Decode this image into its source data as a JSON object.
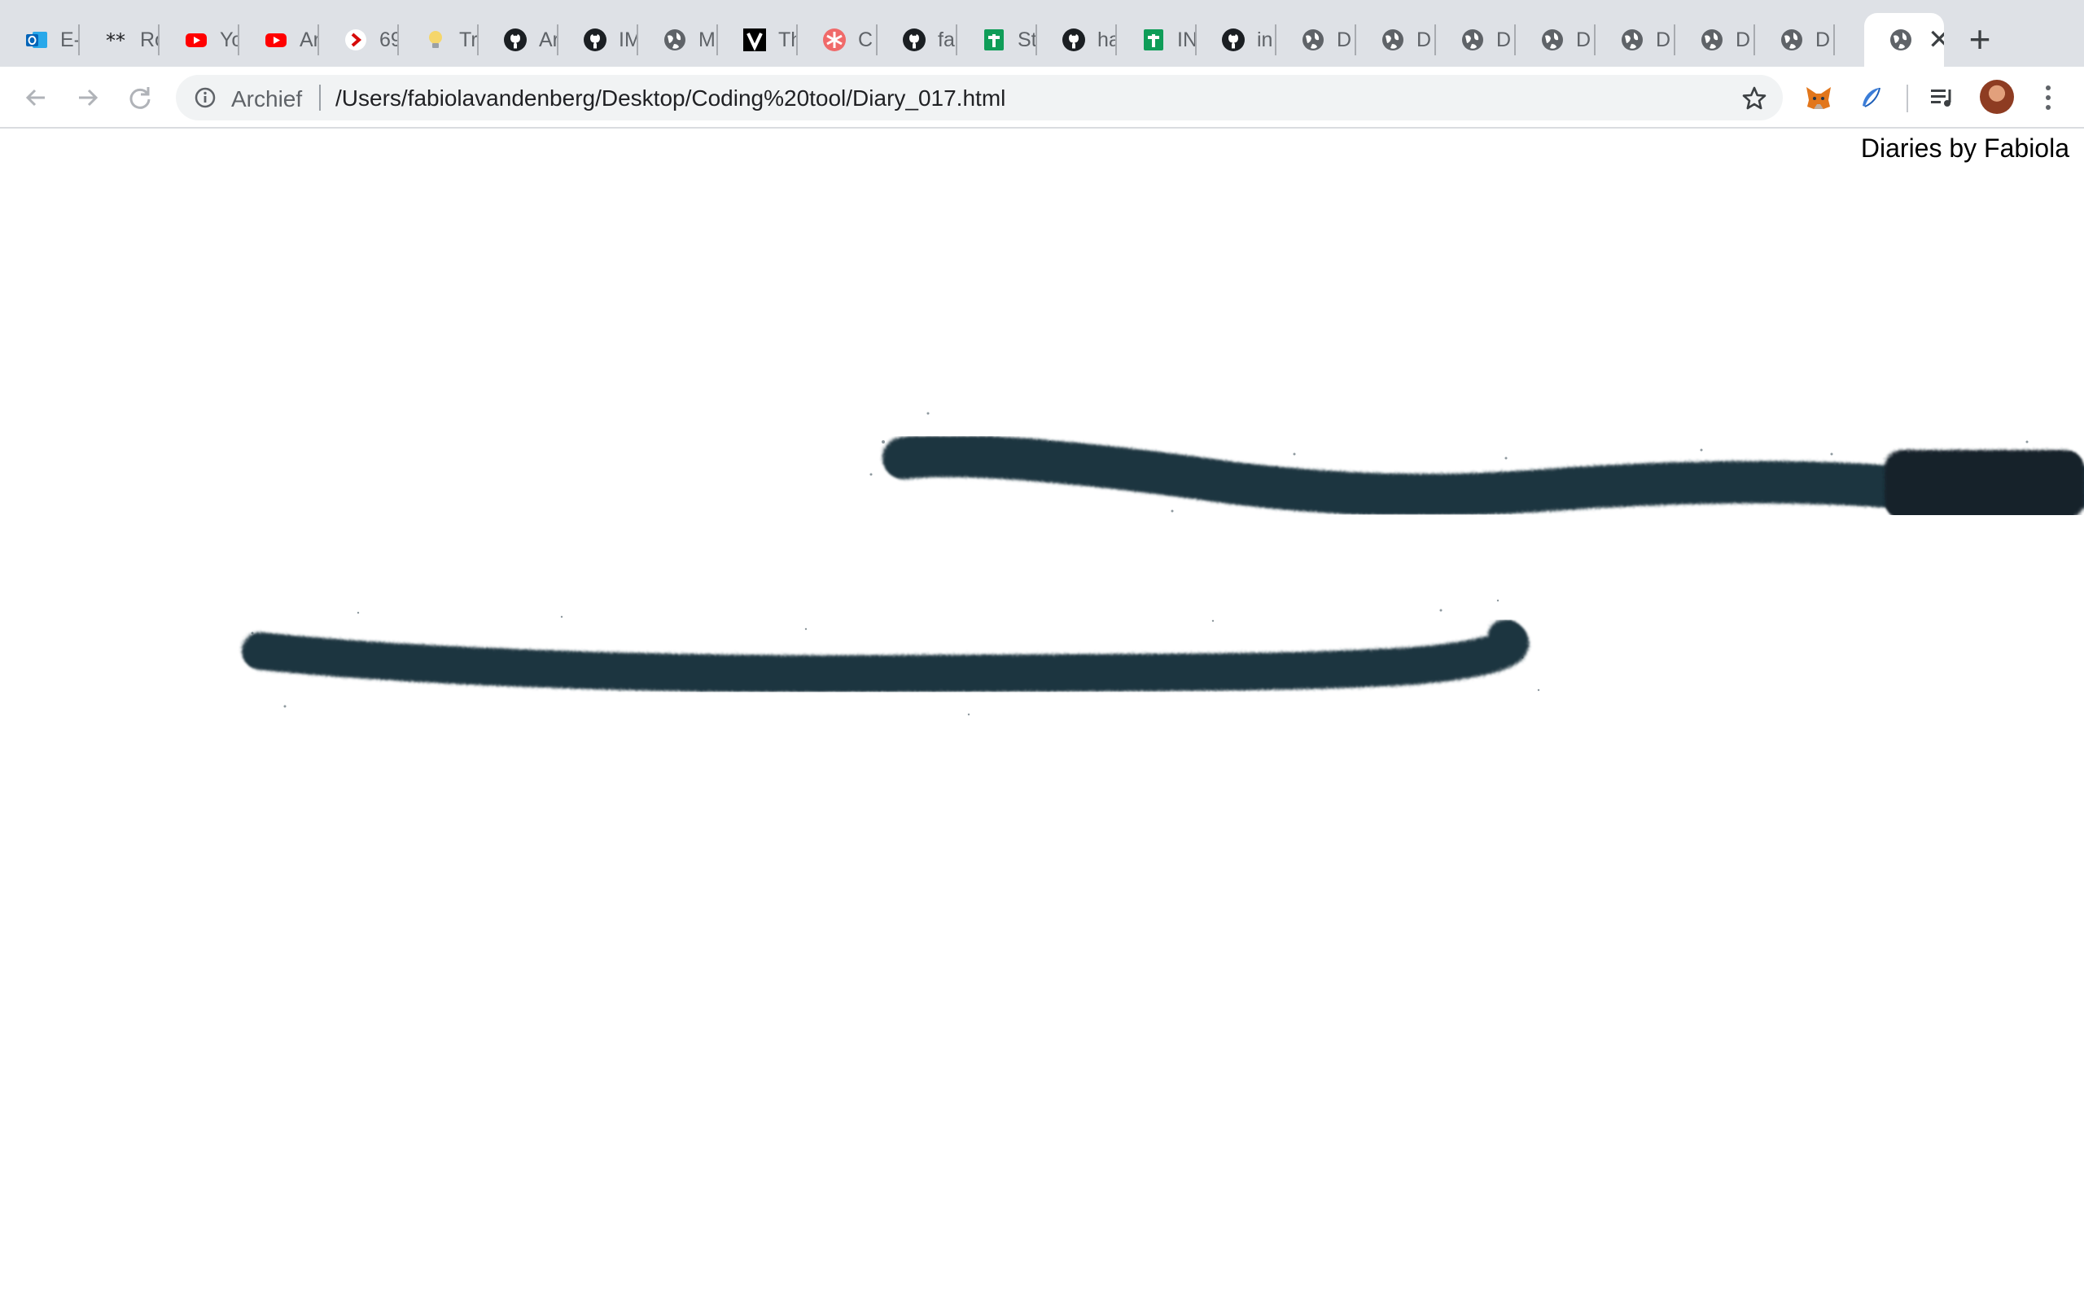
{
  "browser": {
    "tabs": [
      {
        "title": "E-",
        "icon": "outlook-icon"
      },
      {
        "title": "Ro",
        "icon": "asterisks-icon"
      },
      {
        "title": "Yo",
        "icon": "youtube-icon"
      },
      {
        "title": "Ar",
        "icon": "youtube-icon"
      },
      {
        "title": "69",
        "icon": "chevron-red-icon"
      },
      {
        "title": "Tr",
        "icon": "lightbulb-icon"
      },
      {
        "title": "Ar",
        "icon": "github-icon"
      },
      {
        "title": "IM",
        "icon": "github-icon"
      },
      {
        "title": "M",
        "icon": "globe-icon"
      },
      {
        "title": "Th",
        "icon": "v-logo-icon"
      },
      {
        "title": "C",
        "icon": "asterisk-orange-icon"
      },
      {
        "title": "fa",
        "icon": "github-icon"
      },
      {
        "title": "St",
        "icon": "sheets-icon"
      },
      {
        "title": "ha",
        "icon": "github-icon"
      },
      {
        "title": "IN",
        "icon": "sheets-icon"
      },
      {
        "title": "in",
        "icon": "github-icon"
      },
      {
        "title": "D",
        "icon": "globe-icon"
      },
      {
        "title": "D",
        "icon": "globe-icon"
      },
      {
        "title": "D",
        "icon": "globe-icon"
      },
      {
        "title": "D",
        "icon": "globe-icon"
      },
      {
        "title": "D",
        "icon": "globe-icon"
      },
      {
        "title": "D",
        "icon": "globe-icon"
      },
      {
        "title": "D",
        "icon": "globe-icon"
      }
    ],
    "active_tab": {
      "icon": "globe-icon",
      "close": "✕"
    },
    "new_tab_label": "+",
    "address_bar": {
      "security_label": "Archief",
      "url": "/Users/fabiolavandenberg/Desktop/Coding%20tool/Diary_017.html"
    }
  },
  "page": {
    "title": "Diaries by Fabiola",
    "stroke_color": "#1f3540"
  }
}
